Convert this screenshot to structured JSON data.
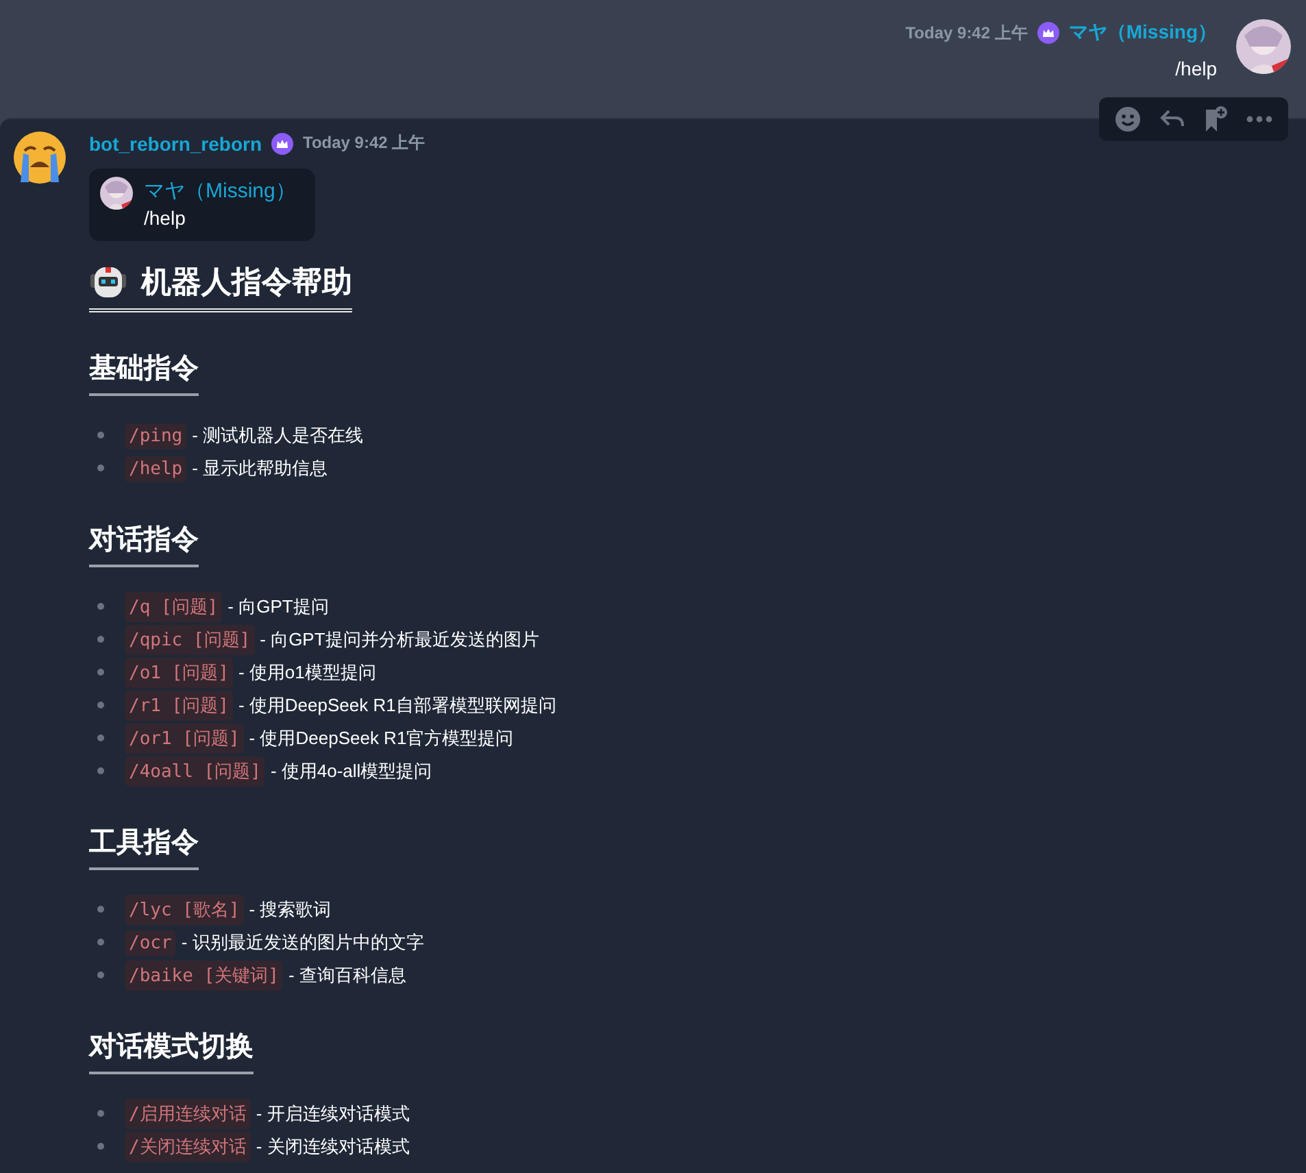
{
  "own_message": {
    "timestamp": "Today 9:42 上午",
    "author": "マヤ（Missing）",
    "text": "/help"
  },
  "bot_message": {
    "author": "bot_reborn_reborn",
    "timestamp": "Today 9:42 上午",
    "reply": {
      "author": "マヤ（Missing）",
      "text": "/help"
    },
    "title": "机器人指令帮助",
    "sections": [
      {
        "title": "基础指令",
        "items": [
          {
            "command": "/ping",
            "description": "- 测试机器人是否在线"
          },
          {
            "command": "/help",
            "description": "- 显示此帮助信息"
          }
        ]
      },
      {
        "title": "对话指令",
        "items": [
          {
            "command": "/q [问题]",
            "description": "- 向GPT提问"
          },
          {
            "command": "/qpic [问题]",
            "description": "- 向GPT提问并分析最近发送的图片"
          },
          {
            "command": "/o1 [问题]",
            "description": "- 使用o1模型提问"
          },
          {
            "command": "/r1 [问题]",
            "description": "- 使用DeepSeek R1自部署模型联网提问"
          },
          {
            "command": "/or1 [问题]",
            "description": "- 使用DeepSeek R1官方模型提问"
          },
          {
            "command": "/4oall [问题]",
            "description": "- 使用4o-all模型提问"
          }
        ]
      },
      {
        "title": "工具指令",
        "items": [
          {
            "command": "/lyc [歌名]",
            "description": "- 搜索歌词"
          },
          {
            "command": "/ocr",
            "description": "- 识别最近发送的图片中的文字"
          },
          {
            "command": "/baike [关键词]",
            "description": "- 查询百科信息"
          }
        ]
      },
      {
        "title": "对话模式切换",
        "items": [
          {
            "command": "/启用连续对话",
            "description": "- 开启连续对话模式"
          },
          {
            "command": "/关闭连续对话",
            "description": "- 关闭连续对话模式"
          }
        ]
      }
    ]
  }
}
